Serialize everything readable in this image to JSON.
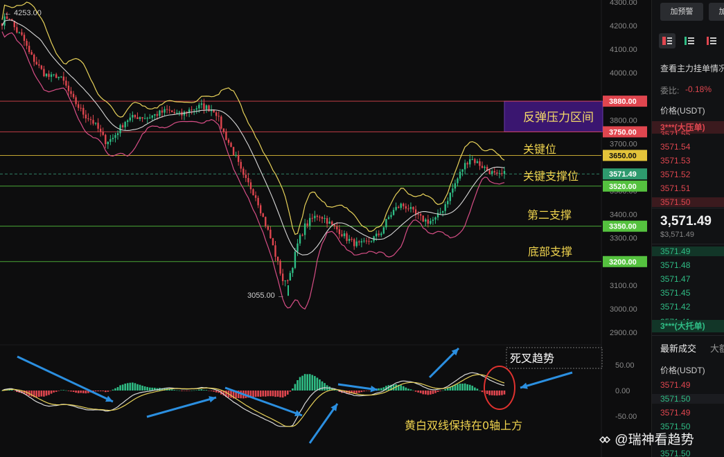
{
  "chart_data": {
    "type": "candlestick",
    "price_axis": {
      "ticks": [
        "4300.00",
        "4200.00",
        "4100.00",
        "4000.00",
        "3800.00",
        "3700.00",
        "3500.00",
        "3400.00",
        "3300.00",
        "3100.00",
        "3000.00",
        "2900.00"
      ],
      "tick_values": [
        4300,
        4200,
        4100,
        4000,
        3800,
        3700,
        3500,
        3400,
        3300,
        3100,
        3000,
        2900
      ],
      "range": [
        2880,
        4310
      ]
    },
    "macd_axis": {
      "ticks": [
        "50.00",
        "0.00",
        "-50.00"
      ],
      "tick_values": [
        50,
        0,
        -50
      ],
      "range": [
        -75,
        60
      ]
    },
    "high_label": "4253.00",
    "high_value": 4253,
    "low_label": "3055.00",
    "low_value": 3055,
    "current_price": "3571.49",
    "current_value": 3571.49,
    "levels": [
      {
        "value": 3880,
        "label": "3880.00",
        "color": "#e0464f"
      },
      {
        "value": 3750,
        "label": "3750.00",
        "color": "#e0464f"
      },
      {
        "value": 3650,
        "label": "3650.00",
        "color": "#e3c33a"
      },
      {
        "value": 3520,
        "label": "3520.00",
        "color": "#55c23f"
      },
      {
        "value": 3350,
        "label": "3350.00",
        "color": "#55c23f"
      },
      {
        "value": 3200,
        "label": "3200.00",
        "color": "#55c23f"
      }
    ],
    "annotations": [
      "反弹压力区间",
      "关键位",
      "关键支撑位",
      "第二支撑",
      "底部支撑",
      "死叉趋势",
      "黄白双线保持在0轴上方"
    ],
    "close_path": [
      4220,
      4240,
      4180,
      4150,
      4080,
      4040,
      4000,
      3980,
      3990,
      3960,
      3900,
      3860,
      3820,
      3800,
      3760,
      3710,
      3720,
      3760,
      3800,
      3810,
      3815,
      3810,
      3820,
      3830,
      3840,
      3830,
      3820,
      3840,
      3850,
      3860,
      3850,
      3840,
      3760,
      3700,
      3640,
      3560,
      3520,
      3470,
      3380,
      3300,
      3200,
      3100,
      3160,
      3280,
      3350,
      3380,
      3400,
      3380,
      3350,
      3330,
      3300,
      3280,
      3270,
      3280,
      3300,
      3320,
      3380,
      3420,
      3440,
      3430,
      3400,
      3380,
      3370,
      3380,
      3420,
      3480,
      3540,
      3600,
      3640,
      3620,
      3600,
      3580,
      3560,
      3571
    ],
    "colors": {
      "up": "#2fbd85",
      "down": "#e0464f",
      "ma_yellow": "#e8d25a",
      "ma_white": "#d8d8d8",
      "band_pink": "#d84e86",
      "arrow": "#2b8fe0",
      "zone": "#3a1670"
    }
  },
  "sidebar": {
    "alert_button": "加预警",
    "next_button": "加",
    "orderbook_title": "查看主力挂单情况",
    "ratio_label": "委比:",
    "ratio_value": "-0.18%",
    "price_header": "价格(USDT)",
    "ask_big": "3***(大压单)",
    "asks": [
      "3571.55",
      "3571.54",
      "3571.53",
      "3571.52",
      "3571.51",
      "3571.50"
    ],
    "last_price": "3,571.49",
    "last_price_usd": "$3,571.49",
    "bids": [
      "3571.49",
      "3571.48",
      "3571.47",
      "3571.45",
      "3571.42",
      "3571.41"
    ],
    "bid_big": "3***(大托单)",
    "trades_title": "最新成交",
    "trades_tab2": "大额",
    "trades_header": "价格(USDT)",
    "trades": [
      "3571.49",
      "3571.50",
      "3571.49",
      "3571.50",
      "3571.50"
    ]
  },
  "watermark": "@瑞神看趋势"
}
